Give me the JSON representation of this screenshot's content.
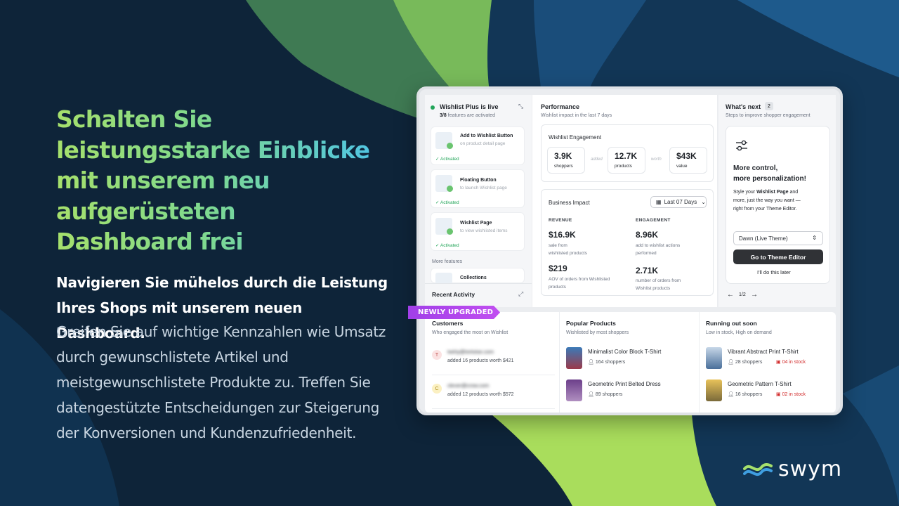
{
  "headline": {
    "line1": "Schalten Sie",
    "line2": "leistungsstarke Einblicke",
    "line3": "mit unserem neu",
    "line4": "aufgerüsteten",
    "line5": "Dashboard frei"
  },
  "subcopy": {
    "lead": "Navigieren Sie mühelos durch die Leistung Ihres Shops mit unserem neuen Dashboard.",
    "body": "Greifen Sie auf wichtige Kennzahlen wie Umsatz durch gewunschlistete Artikel und meistgewunschlistete Produkte zu. Treffen Sie datengestützte Entscheidungen zur Steigerung der Konversionen und Kundenzufriedenheit."
  },
  "logo": {
    "word": "swym"
  },
  "colors": {
    "accent_green": "#a6e06c",
    "accent_blue": "#4fc5e6",
    "purple_badge": "#a13fe8",
    "activated_green": "#22a559",
    "stock_red": "#d22c2c"
  },
  "dashboard": {
    "features_panel": {
      "title": "Wishlist Plus is live",
      "count": "3/8",
      "count_suffix": "features are activated",
      "collapse_icon": "collapse-icon",
      "items": [
        {
          "title": "Add to Wishlist Button",
          "subtitle": "on product detail page",
          "status": "Activated"
        },
        {
          "title": "Floating Button",
          "subtitle": "to launch Wishlist page",
          "status": "Activated"
        },
        {
          "title": "Wishlist Page",
          "subtitle": "to view wishlisted items",
          "status": "Activated"
        }
      ],
      "more_label": "More features",
      "more_item": "Collections",
      "recent_activity": "Recent Activity"
    },
    "performance": {
      "title": "Performance",
      "subtitle": "Wishlist impact in the last 7 days",
      "engagement": {
        "title": "Wishlist Engagement",
        "stats": [
          {
            "value": "3.9K",
            "label": "shoppers"
          },
          {
            "value": "12.7K",
            "label": "products"
          },
          {
            "value": "$43K",
            "label": "value"
          }
        ],
        "connector1": "added",
        "connector2": "worth"
      },
      "business": {
        "title": "Business Impact",
        "range": "Last 07 Days",
        "revenue_label": "REVENUE",
        "engagement_label": "ENGAGEMENT",
        "metrics": [
          {
            "value": "$16.9K",
            "desc1": "sale from",
            "desc2": "wishlisted products"
          },
          {
            "value": "8.96K",
            "desc1": "add to wishlist actions",
            "desc2": "performed"
          },
          {
            "value": "$219",
            "desc1": "AOV of orders from Wishlisted",
            "desc2": "products"
          },
          {
            "value": "2.71K",
            "desc1": "number of orders from",
            "desc2": "Wishlist products"
          }
        ]
      }
    },
    "whats_next": {
      "title": "What's next",
      "count": "2",
      "subtitle": "Steps to improve shopper engagement",
      "card_title1": "More control,",
      "card_title2": "more personalization!",
      "desc_a": "Style your ",
      "desc_b": "Wishlist Page",
      "desc_c": " and",
      "desc_line2": "more, just the way you want —",
      "desc_line3": "right from your Theme Editor.",
      "theme_select": "Dawn (Live Theme)",
      "primary_button": "Go to Theme Editor",
      "secondary_button": "I'll do this later",
      "pager": "1/2"
    },
    "badge": "NEWLY UPGRADED",
    "customers": {
      "title": "Customers",
      "subtitle": "Who engaged the most on Wishlist",
      "rows": [
        {
          "initial": "T",
          "email": "twirty@tortoise.com",
          "detail": "added 16 products worth $421"
        },
        {
          "initial": "C",
          "email": "clever@crow.com",
          "detail": "added 12 products worth $572"
        }
      ]
    },
    "popular": {
      "title": "Popular Products",
      "subtitle": "Wishlisted by most shoppers",
      "rows": [
        {
          "name": "Minimalist Color Block T-Shirt",
          "shoppers": "164 shoppers"
        },
        {
          "name": "Geometric Print Belted Dress",
          "shoppers": "89 shoppers"
        }
      ]
    },
    "running_out": {
      "title": "Running out soon",
      "subtitle": "Low in stock, High on demand",
      "rows": [
        {
          "name": "Vibrant Abstract Print T-Shirt",
          "shoppers": "28 shoppers",
          "stock": "04 in stock"
        },
        {
          "name": "Geometric Pattern T-Shirt",
          "shoppers": "16 shoppers",
          "stock": "02 in stock"
        }
      ]
    }
  }
}
